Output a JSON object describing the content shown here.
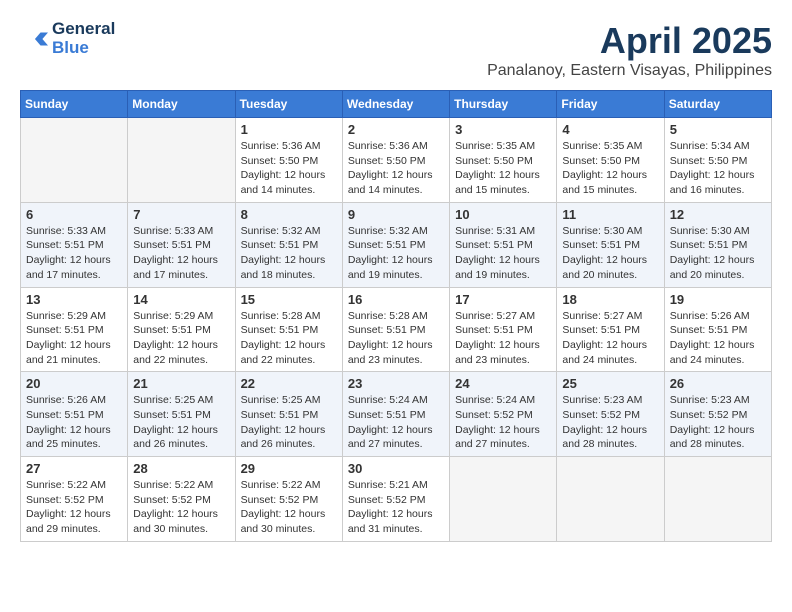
{
  "header": {
    "logo_line1": "General",
    "logo_line2": "Blue",
    "month": "April 2025",
    "location": "Panalanoy, Eastern Visayas, Philippines"
  },
  "weekdays": [
    "Sunday",
    "Monday",
    "Tuesday",
    "Wednesday",
    "Thursday",
    "Friday",
    "Saturday"
  ],
  "rows": [
    [
      {
        "day": "",
        "info": ""
      },
      {
        "day": "",
        "info": ""
      },
      {
        "day": "1",
        "info": "Sunrise: 5:36 AM\nSunset: 5:50 PM\nDaylight: 12 hours and 14 minutes."
      },
      {
        "day": "2",
        "info": "Sunrise: 5:36 AM\nSunset: 5:50 PM\nDaylight: 12 hours and 14 minutes."
      },
      {
        "day": "3",
        "info": "Sunrise: 5:35 AM\nSunset: 5:50 PM\nDaylight: 12 hours and 15 minutes."
      },
      {
        "day": "4",
        "info": "Sunrise: 5:35 AM\nSunset: 5:50 PM\nDaylight: 12 hours and 15 minutes."
      },
      {
        "day": "5",
        "info": "Sunrise: 5:34 AM\nSunset: 5:50 PM\nDaylight: 12 hours and 16 minutes."
      }
    ],
    [
      {
        "day": "6",
        "info": "Sunrise: 5:33 AM\nSunset: 5:51 PM\nDaylight: 12 hours and 17 minutes."
      },
      {
        "day": "7",
        "info": "Sunrise: 5:33 AM\nSunset: 5:51 PM\nDaylight: 12 hours and 17 minutes."
      },
      {
        "day": "8",
        "info": "Sunrise: 5:32 AM\nSunset: 5:51 PM\nDaylight: 12 hours and 18 minutes."
      },
      {
        "day": "9",
        "info": "Sunrise: 5:32 AM\nSunset: 5:51 PM\nDaylight: 12 hours and 19 minutes."
      },
      {
        "day": "10",
        "info": "Sunrise: 5:31 AM\nSunset: 5:51 PM\nDaylight: 12 hours and 19 minutes."
      },
      {
        "day": "11",
        "info": "Sunrise: 5:30 AM\nSunset: 5:51 PM\nDaylight: 12 hours and 20 minutes."
      },
      {
        "day": "12",
        "info": "Sunrise: 5:30 AM\nSunset: 5:51 PM\nDaylight: 12 hours and 20 minutes."
      }
    ],
    [
      {
        "day": "13",
        "info": "Sunrise: 5:29 AM\nSunset: 5:51 PM\nDaylight: 12 hours and 21 minutes."
      },
      {
        "day": "14",
        "info": "Sunrise: 5:29 AM\nSunset: 5:51 PM\nDaylight: 12 hours and 22 minutes."
      },
      {
        "day": "15",
        "info": "Sunrise: 5:28 AM\nSunset: 5:51 PM\nDaylight: 12 hours and 22 minutes."
      },
      {
        "day": "16",
        "info": "Sunrise: 5:28 AM\nSunset: 5:51 PM\nDaylight: 12 hours and 23 minutes."
      },
      {
        "day": "17",
        "info": "Sunrise: 5:27 AM\nSunset: 5:51 PM\nDaylight: 12 hours and 23 minutes."
      },
      {
        "day": "18",
        "info": "Sunrise: 5:27 AM\nSunset: 5:51 PM\nDaylight: 12 hours and 24 minutes."
      },
      {
        "day": "19",
        "info": "Sunrise: 5:26 AM\nSunset: 5:51 PM\nDaylight: 12 hours and 24 minutes."
      }
    ],
    [
      {
        "day": "20",
        "info": "Sunrise: 5:26 AM\nSunset: 5:51 PM\nDaylight: 12 hours and 25 minutes."
      },
      {
        "day": "21",
        "info": "Sunrise: 5:25 AM\nSunset: 5:51 PM\nDaylight: 12 hours and 26 minutes."
      },
      {
        "day": "22",
        "info": "Sunrise: 5:25 AM\nSunset: 5:51 PM\nDaylight: 12 hours and 26 minutes."
      },
      {
        "day": "23",
        "info": "Sunrise: 5:24 AM\nSunset: 5:51 PM\nDaylight: 12 hours and 27 minutes."
      },
      {
        "day": "24",
        "info": "Sunrise: 5:24 AM\nSunset: 5:52 PM\nDaylight: 12 hours and 27 minutes."
      },
      {
        "day": "25",
        "info": "Sunrise: 5:23 AM\nSunset: 5:52 PM\nDaylight: 12 hours and 28 minutes."
      },
      {
        "day": "26",
        "info": "Sunrise: 5:23 AM\nSunset: 5:52 PM\nDaylight: 12 hours and 28 minutes."
      }
    ],
    [
      {
        "day": "27",
        "info": "Sunrise: 5:22 AM\nSunset: 5:52 PM\nDaylight: 12 hours and 29 minutes."
      },
      {
        "day": "28",
        "info": "Sunrise: 5:22 AM\nSunset: 5:52 PM\nDaylight: 12 hours and 30 minutes."
      },
      {
        "day": "29",
        "info": "Sunrise: 5:22 AM\nSunset: 5:52 PM\nDaylight: 12 hours and 30 minutes."
      },
      {
        "day": "30",
        "info": "Sunrise: 5:21 AM\nSunset: 5:52 PM\nDaylight: 12 hours and 31 minutes."
      },
      {
        "day": "",
        "info": ""
      },
      {
        "day": "",
        "info": ""
      },
      {
        "day": "",
        "info": ""
      }
    ]
  ]
}
